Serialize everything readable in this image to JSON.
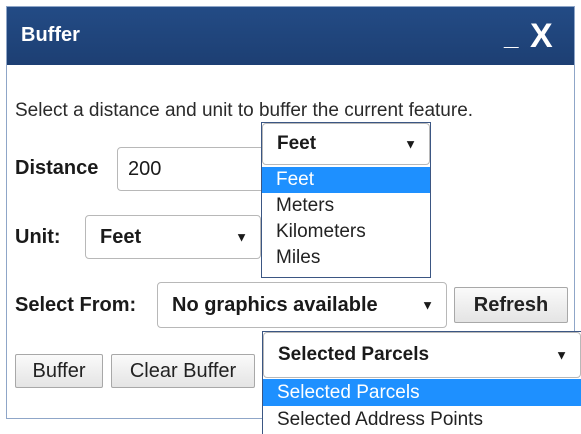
{
  "dialog": {
    "title": "Buffer",
    "minimize_glyph": "_",
    "close_glyph": "X",
    "instructions": "Select a distance and unit to buffer the current feature."
  },
  "distance": {
    "label": "Distance",
    "value": "200",
    "unit_selected": "Feet",
    "unit_options": [
      "Feet",
      "Meters",
      "Kilometers",
      "Miles"
    ],
    "highlighted_index": 0
  },
  "unit": {
    "label": "Unit:",
    "value": "Feet"
  },
  "select_from": {
    "label": "Select From:",
    "value": "No graphics available",
    "refresh_label": "Refresh"
  },
  "actions": {
    "buffer_label": "Buffer",
    "clear_label": "Clear Buffer"
  },
  "selection_dropdown": {
    "value": "Selected Parcels",
    "options": [
      "Selected Parcels",
      "Selected Address Points"
    ],
    "highlighted_index": 0
  },
  "icons": {
    "caret": "caret-down-icon"
  },
  "colors": {
    "titlebar": "#1f4379",
    "highlight": "#1e90ff"
  }
}
